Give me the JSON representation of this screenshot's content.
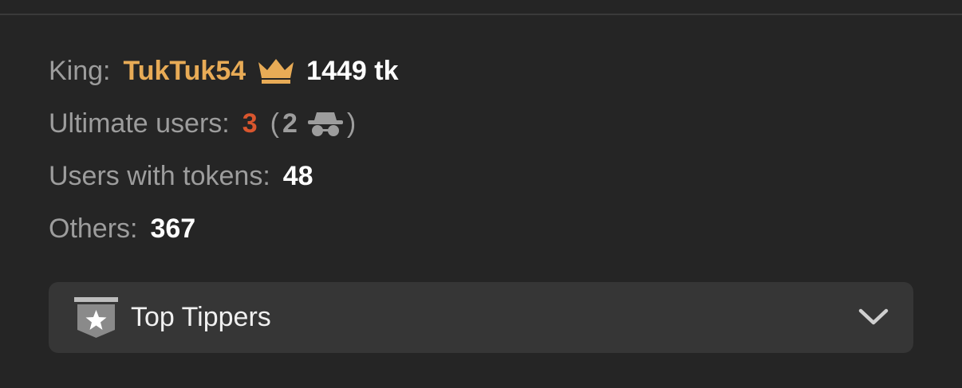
{
  "stats": {
    "king": {
      "label": "King:",
      "name": "TukTuk54",
      "icon": "crown-icon",
      "tokens": "1449 tk"
    },
    "ultimate": {
      "label": "Ultimate users:",
      "count": "3",
      "paren_open": "(",
      "anonymous_count": "2",
      "anonymous_icon": "incognito-icon",
      "paren_close": ")"
    },
    "with_tokens": {
      "label": "Users with tokens:",
      "count": "48"
    },
    "others": {
      "label": "Others:",
      "count": "367"
    }
  },
  "dropdown": {
    "icon": "star-badge-icon",
    "label": "Top Tippers",
    "toggle_icon": "chevron-down-icon"
  },
  "colors": {
    "background": "#252525",
    "king_name": "#e8ab56",
    "ultimate_count": "#d9562e",
    "muted_text": "#9d9d9d",
    "dropdown_bg": "#363636"
  }
}
